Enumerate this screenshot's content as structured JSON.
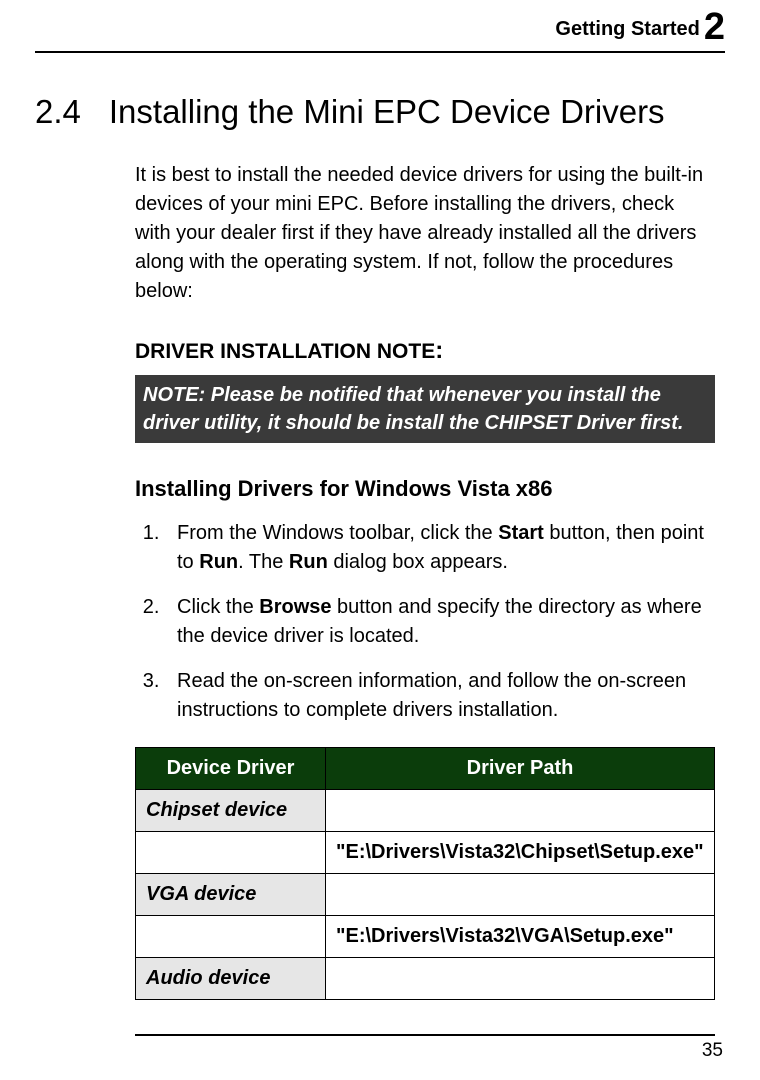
{
  "header": {
    "running_title": "Getting Started",
    "chapter_number": "2"
  },
  "section": {
    "number": "2.4",
    "title": "Installing the Mini EPC Device Drivers",
    "intro": "It is best to install the needed device drivers for using the built-in devices of your mini EPC. Before installing the drivers, check with your dealer first if they have already installed all the drivers along with the operating system. If not, follow the procedures below:"
  },
  "install_note": {
    "heading": "DRIVER INSTALLATION NOTE",
    "text": "NOTE: Please be notified that whenever you install the driver utility, it should be install the CHIPSET Driver first."
  },
  "vista": {
    "heading": "Installing Drivers for Windows Vista x86",
    "steps": {
      "s1_a": "From the Windows toolbar, click the ",
      "s1_b": "Start",
      "s1_c": " button, then point to ",
      "s1_d": "Run",
      "s1_e": ". The ",
      "s1_f": "Run",
      "s1_g": " dialog box appears.",
      "s2_a": "Click the ",
      "s2_b": "Browse",
      "s2_c": " button and specify the directory as where the device driver is located.",
      "s3": "Read the on-screen information, and follow the on-screen instructions to complete drivers installation."
    }
  },
  "table": {
    "headers": {
      "device": "Device Driver",
      "path": "Driver Path"
    },
    "rows": {
      "r0_label": "Chipset device",
      "r0_path": "\"E:\\Drivers\\Vista32\\Chipset\\Setup.exe\"",
      "r1_label": "VGA device",
      "r1_path": "\"E:\\Drivers\\Vista32\\VGA\\Setup.exe\"",
      "r2_label": "Audio device"
    }
  },
  "footer": {
    "page_number": "35"
  }
}
